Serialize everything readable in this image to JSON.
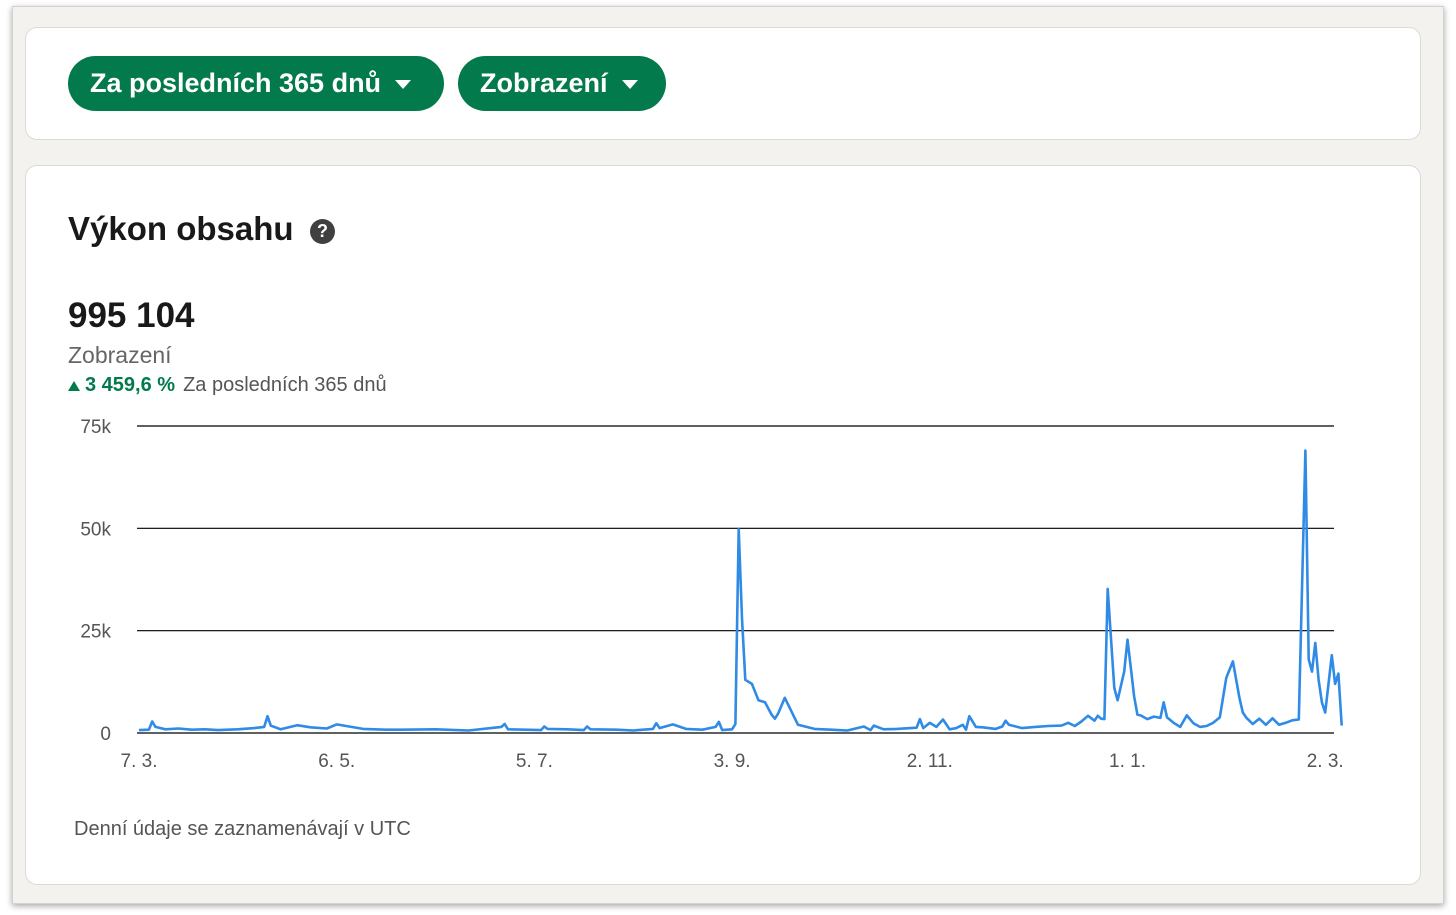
{
  "filters": {
    "period_label": "Za posledních 365 dnů",
    "metric_label": "Zobrazení"
  },
  "section": {
    "title": "Výkon obsahu",
    "total": "995 104",
    "metric": "Zobrazení",
    "change": "3 459,6 %",
    "change_period": "Za posledních 365 dnů",
    "footnote": "Denní údaje se zaznamenávají v UTC"
  },
  "colors": {
    "accent_green": "#037a4c",
    "line_blue": "#2f8be6"
  },
  "icons": {
    "help": "question-circle-icon",
    "dropdown": "caret-down-icon",
    "trend": "arrow-up-icon"
  },
  "chart_data": {
    "type": "line",
    "title": "",
    "xlabel": "",
    "ylabel": "",
    "ylim": [
      0,
      75000
    ],
    "y_ticks": [
      0,
      25000,
      50000,
      75000
    ],
    "y_tick_labels": [
      "0",
      "25k",
      "50k",
      "75k"
    ],
    "x_tick_labels": [
      "7. 3.",
      "6. 5.",
      "5. 7.",
      "3. 9.",
      "2. 11.",
      "1. 1.",
      "2. 3."
    ],
    "x_tick_days": [
      0,
      60,
      120,
      180,
      240,
      300,
      360
    ],
    "grid": true,
    "legend": "none",
    "series": [
      {
        "x_day": [
          0,
          3,
          4,
          5,
          8,
          12,
          16,
          20,
          24,
          30,
          35,
          38,
          39,
          40,
          43,
          48,
          52,
          57,
          60,
          68,
          75,
          80,
          90,
          100,
          110,
          111,
          112,
          122,
          123,
          124,
          130,
          135,
          136,
          137,
          145,
          150,
          156,
          157,
          158,
          162,
          166,
          171,
          175,
          176,
          177,
          180,
          181,
          182,
          183,
          184,
          186,
          188,
          190,
          192,
          193,
          194,
          196,
          200,
          205,
          210,
          215,
          220,
          222,
          223,
          226,
          230,
          236,
          237,
          238,
          240,
          242,
          244,
          246,
          248,
          250,
          251,
          252,
          254,
          256,
          260,
          262,
          263,
          264,
          268,
          272,
          276,
          280,
          282,
          284,
          286,
          288,
          290,
          291,
          292,
          293,
          294,
          296,
          297,
          299,
          300,
          301,
          302,
          303,
          304,
          306,
          308,
          310,
          311,
          312,
          314,
          316,
          318,
          320,
          322,
          324,
          326,
          328,
          330,
          332,
          334,
          335,
          336,
          338,
          340,
          342,
          344,
          346,
          348,
          350,
          352,
          354,
          355,
          356,
          357,
          358,
          359,
          360,
          362,
          363,
          364,
          365
        ],
        "values": [
          700,
          800,
          2800,
          1500,
          900,
          1100,
          800,
          900,
          700,
          900,
          1200,
          1500,
          4100,
          1800,
          900,
          1900,
          1400,
          1100,
          2100,
          1000,
          800,
          800,
          900,
          600,
          1500,
          2200,
          900,
          700,
          1600,
          1000,
          900,
          700,
          1600,
          900,
          800,
          600,
          1000,
          2400,
          1200,
          2100,
          1000,
          800,
          1500,
          2700,
          700,
          900,
          2200,
          49800,
          28000,
          13000,
          12000,
          8000,
          7500,
          4500,
          3500,
          4800,
          8600,
          2000,
          1000,
          800,
          600,
          1600,
          700,
          1800,
          900,
          1000,
          1300,
          3400,
          1200,
          2500,
          1500,
          3300,
          900,
          1200,
          2000,
          800,
          4100,
          1500,
          1400,
          1000,
          1600,
          3000,
          2000,
          1200,
          1500,
          1700,
          1800,
          2500,
          1700,
          2800,
          4200,
          3000,
          4200,
          3500,
          3400,
          35200,
          11000,
          8000,
          15000,
          22800,
          16000,
          9000,
          4500,
          4300,
          3400,
          4000,
          3700,
          7500,
          3800,
          2500,
          1500,
          4300,
          2400,
          1500,
          1700,
          2500,
          3800,
          13500,
          17500,
          8500,
          5000,
          3800,
          2200,
          3500,
          2000,
          3600,
          2000,
          2500,
          3100,
          3300,
          69000,
          18000,
          15000,
          22000,
          13000,
          7500,
          5000,
          19000,
          12000,
          14500,
          1800
        ]
      }
    ]
  }
}
